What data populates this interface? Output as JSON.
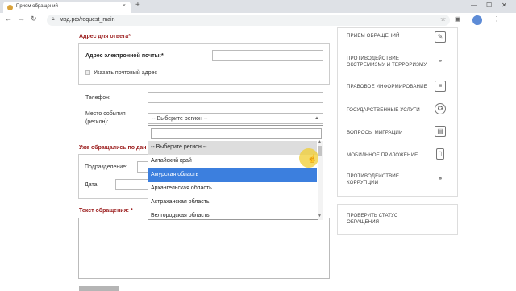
{
  "browser": {
    "tab_title": "Прием обращений",
    "url": "мвд.рф/request_main",
    "new_tab_symbol": "+",
    "close_symbol": "×",
    "min_symbol": "—",
    "max_symbol": "☐",
    "win_close_symbol": "✕"
  },
  "form": {
    "reply_address_title": "Адрес для ответа",
    "required_star": "*",
    "email_label": "Адрес электронной почты:",
    "postal_checkbox_label": "Указать почтовый адрес",
    "phone_label": "Телефон:",
    "event_place_label_1": "Место события",
    "event_place_label_2": "(регион):",
    "region_placeholder": "-- Выберите регион --",
    "already_applied_title": "Уже обращались по дан",
    "department_label": "Подразделение:",
    "date_label": "Дата:",
    "request_text_title": "Текст обращения:"
  },
  "dropdown": {
    "items": [
      {
        "label": "-- Выберите регион --",
        "state": "selected"
      },
      {
        "label": "Алтайский край",
        "state": "normal"
      },
      {
        "label": "Амурская область",
        "state": "highlighted"
      },
      {
        "label": "Архангельская область",
        "state": "normal"
      },
      {
        "label": "Астраханская область",
        "state": "normal"
      },
      {
        "label": "Белгородская область",
        "state": "normal"
      }
    ]
  },
  "sidebar": {
    "items": [
      {
        "label_lines": [
          "ПРИЕМ ОБРАЩЕНИЙ"
        ],
        "icon": "pen-icon"
      },
      {
        "label_lines": [
          "ПРОТИВОДЕЙСТВИЕ",
          "ЭКСТРЕМИЗМУ И ТЕРРОРИЗМУ"
        ],
        "icon": "handcuffs-icon"
      },
      {
        "label_lines": [
          "ПРАВОВОЕ ИНФОРМИРОВАНИЕ"
        ],
        "icon": "document-icon"
      },
      {
        "label_lines": [
          "ГОСУДАРСТВЕННЫЕ УСЛУГИ"
        ],
        "icon": "emblem-icon"
      },
      {
        "label_lines": [
          "ВОПРОСЫ МИГРАЦИИ"
        ],
        "icon": "passport-icon"
      },
      {
        "label_lines": [
          "МОБИЛЬНОЕ ПРИЛОЖЕНИЕ"
        ],
        "icon": "phone-icon"
      },
      {
        "label_lines": [
          "ПРОТИВОДЕЙСТВИЕ",
          "КОРРУПЦИИ"
        ],
        "icon": "handcuffs-icon"
      }
    ],
    "status_lines": [
      "ПРОВЕРИТЬ СТАТУС",
      "ОБРАЩЕНИЯ"
    ]
  },
  "colors": {
    "accent_red": "#9b1c1c",
    "highlight_blue": "#3c7fde",
    "cursor_highlight": "#f0cd32"
  }
}
